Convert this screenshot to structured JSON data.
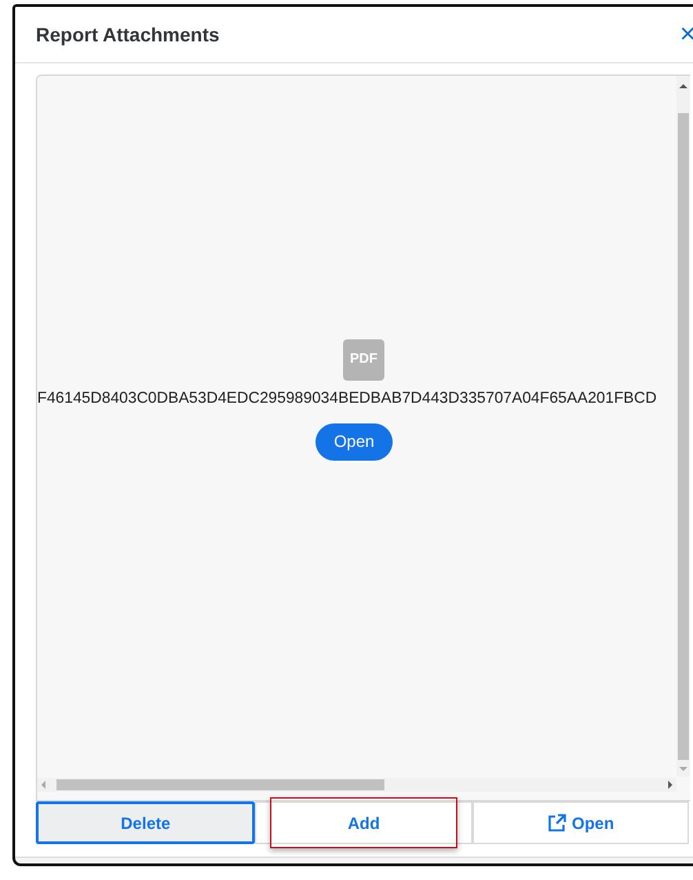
{
  "dialog": {
    "title": "Report Attachments",
    "close": "×"
  },
  "attachment": {
    "file_badge": "PDF",
    "file_name": "F46145D8403C0DBA53D4EDC295989034BEDBAB7D443D335707A04F65AA201FBCD",
    "open_button": "Open"
  },
  "buttons": [
    {
      "label": "Delete",
      "kind": "plain",
      "focused": true,
      "highlighted": false
    },
    {
      "label": "Add",
      "kind": "plain",
      "focused": false,
      "highlighted": true
    },
    {
      "label": "Open",
      "kind": "external",
      "focused": false,
      "highlighted": false
    }
  ]
}
